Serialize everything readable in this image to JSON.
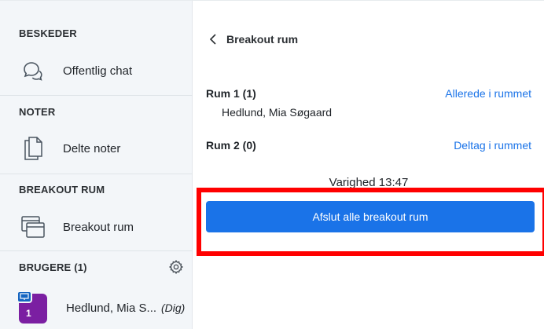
{
  "sidebar": {
    "sections": {
      "messages": "BESKEDER",
      "notes": "NOTER",
      "breakout": "BREAKOUT RUM",
      "users": "BRUGERE (1)"
    },
    "items": {
      "public_chat": "Offentlig chat",
      "shared_notes": "Delte noter",
      "breakout_rooms": "Breakout rum"
    },
    "user": {
      "name": "Hedlund, Mia S...",
      "tag": "(Dig)",
      "avatar_number": "1"
    },
    "icons": {
      "chat": "chat-bubbles-icon",
      "notes": "document-icon",
      "breakout": "window-stack-icon",
      "settings": "gear-icon",
      "badge": "presenter-screen-icon"
    }
  },
  "main": {
    "back_title": "Breakout rum",
    "rooms": [
      {
        "title": "Rum 1 (1)",
        "members": [
          "Hedlund, Mia Søgaard"
        ],
        "action": "Allerede i rummet"
      },
      {
        "title": "Rum 2 (0)",
        "members": [],
        "action": "Deltag i rummet"
      }
    ],
    "duration_text": "Varighed 13:47",
    "end_button": "Afslut alle breakout rum"
  },
  "colors": {
    "accent": "#1a73e8",
    "highlight_border": "#ff0000",
    "avatar": "#7b1fa2",
    "sidebar_bg": "#f3f6f9"
  }
}
